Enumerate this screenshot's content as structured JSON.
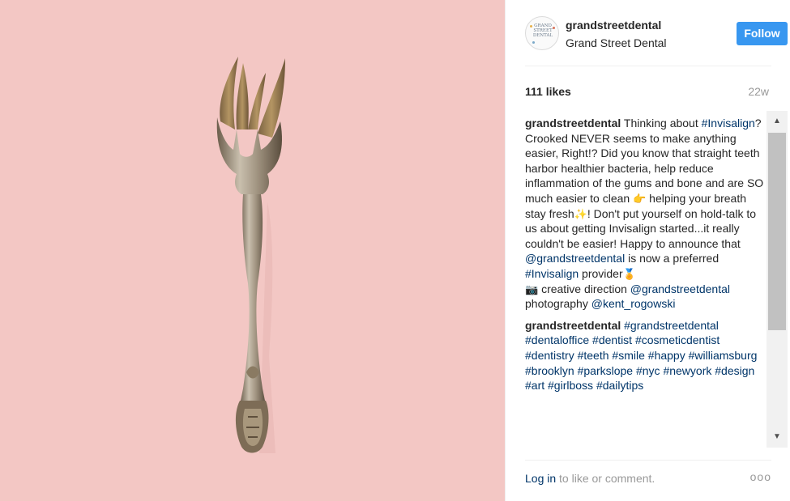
{
  "post": {
    "username": "grandstreetdental",
    "full_name": "Grand Street Dental",
    "follow_label": "Follow",
    "likes": "111 likes",
    "age": "22w",
    "avatar_text": "GRAND STREET DENTAL"
  },
  "comments": {
    "c1": {
      "user": "grandstreetdental",
      "t1": " Thinking about ",
      "tag1": "#Invisalign",
      "t2": "? Crooked NEVER seems to make anything easier, Right!? Did you know that straight teeth harbor healthier bacteria, help reduce inflammation of the gums and bone and are SO much easier to clean ",
      "e1": "👉",
      "t3": " helping your breath stay fresh",
      "e2": "✨",
      "t4": "! Don't put yourself on hold-talk to us about getting Invisalign started...it really couldn't be easier! Happy to announce that ",
      "mention1": "@grandstreetdental",
      "t5": " is now a preferred ",
      "tag2": "#Invisalign",
      "t6": " provider",
      "e3": "🏅",
      "e4": "📷",
      "t7": " creative direction ",
      "mention2": "@grandstreetdental",
      "t8": " photography ",
      "mention3": "@kent_rogowski"
    },
    "c2": {
      "user": "grandstreetdental",
      "tags": [
        "#grandstreetdental",
        "#dentaloffice",
        "#dentist",
        "#cosmeticdentist",
        "#dentistry",
        "#teeth",
        "#smile",
        "#happy",
        "#williamsburg",
        "#brooklyn",
        "#parkslope",
        "#nyc",
        "#newyork",
        "#design",
        "#art",
        "#girlboss",
        "#dailytips"
      ]
    }
  },
  "footer": {
    "login_link": "Log in",
    "login_text": " to like or comment.",
    "more": "ooo"
  },
  "colors": {
    "photo_background": "#f3c7c4",
    "follow_button": "#3897f0",
    "link": "#003569"
  },
  "icons": {
    "scroll_up": "triangle-up-icon",
    "scroll_down": "triangle-down-icon",
    "more_options": "ellipsis-icon"
  }
}
